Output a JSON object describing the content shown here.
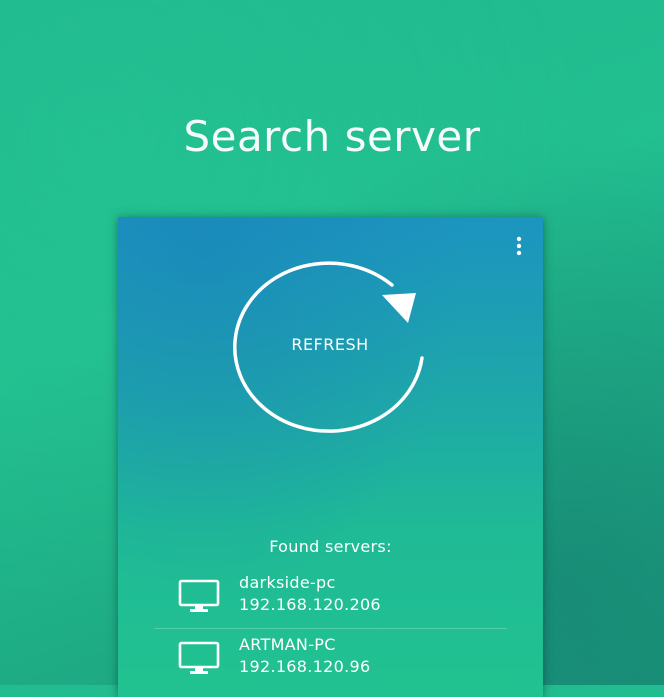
{
  "screen": {
    "title": "Search server"
  },
  "card": {
    "menu_icon": "more-vertical-icon",
    "refresh_label": "REFRESH",
    "refresh_icon": "circular-arrow-icon",
    "found_heading": "Found servers:",
    "servers": [
      {
        "name": "darkside-pc",
        "ip": "192.168.120.206",
        "icon": "monitor-icon"
      },
      {
        "name": "ARTMAN-PC",
        "ip": "192.168.120.96",
        "icon": "monitor-icon"
      }
    ]
  },
  "colors": {
    "background": "#1fb88e",
    "card_top": "#1c94c0",
    "card_bottom": "#22c290",
    "text": "#ffffff"
  }
}
